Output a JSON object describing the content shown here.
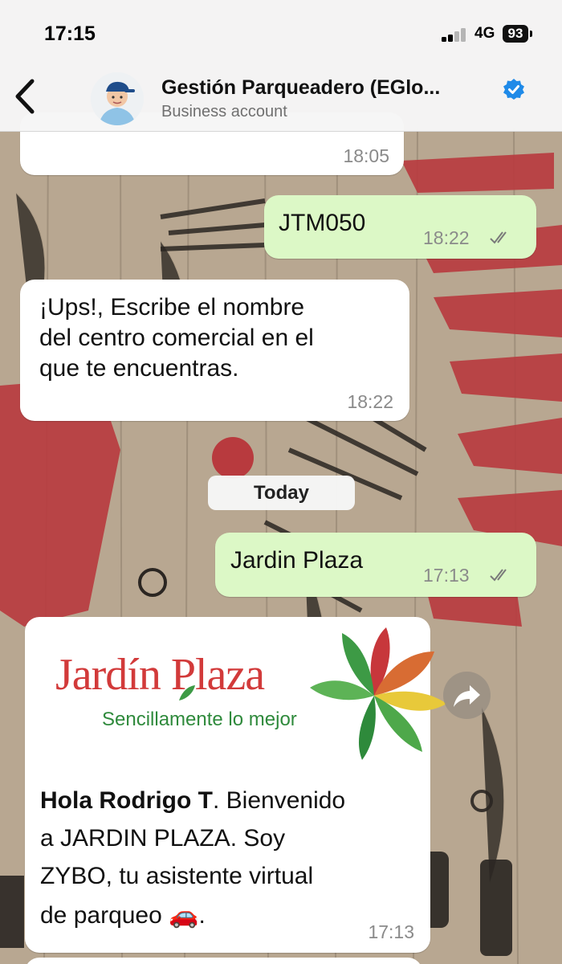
{
  "status_bar": {
    "time": "17:15",
    "network": "4G",
    "battery": "93"
  },
  "header": {
    "back_icon": "chevron-left-icon",
    "contact_name": "Gestión Parqueadero (EGlo...",
    "subtitle": "Business account",
    "verified_icon": "verified-badge-icon"
  },
  "messages": [
    {
      "direction": "incoming",
      "text": "",
      "time": "18:05"
    },
    {
      "direction": "outgoing",
      "text": "JTM050",
      "time": "18:22",
      "status": "read"
    },
    {
      "direction": "incoming",
      "lines": [
        "¡Ups!, Escribe el nombre",
        "del centro comercial en el",
        "que te encuentras."
      ],
      "time": "18:22"
    },
    {
      "direction": "outgoing",
      "text": "Jardin Plaza",
      "time": "17:13",
      "status": "read"
    },
    {
      "direction": "incoming",
      "image": {
        "logo_name": "Jardín Plaza",
        "tagline": "Sencillamente lo mejor"
      },
      "bold_lead": "Hola Rodrigo T",
      "lines_after": [
        ". Bienvenido",
        "a JARDIN PLAZA. Soy",
        "ZYBO, tu asistente virtual",
        "de parqueo"
      ],
      "emoji": "🚗",
      "trailing": ".",
      "time": "17:13"
    }
  ],
  "day_separator": "Today",
  "forward_icon": "forward-share-icon",
  "colors": {
    "incoming": "#ffffff",
    "outgoing": "#dcf8c6",
    "accent": "#1f8ae8",
    "logo_red": "#d23a3a",
    "logo_green": "#2f8a3c"
  }
}
